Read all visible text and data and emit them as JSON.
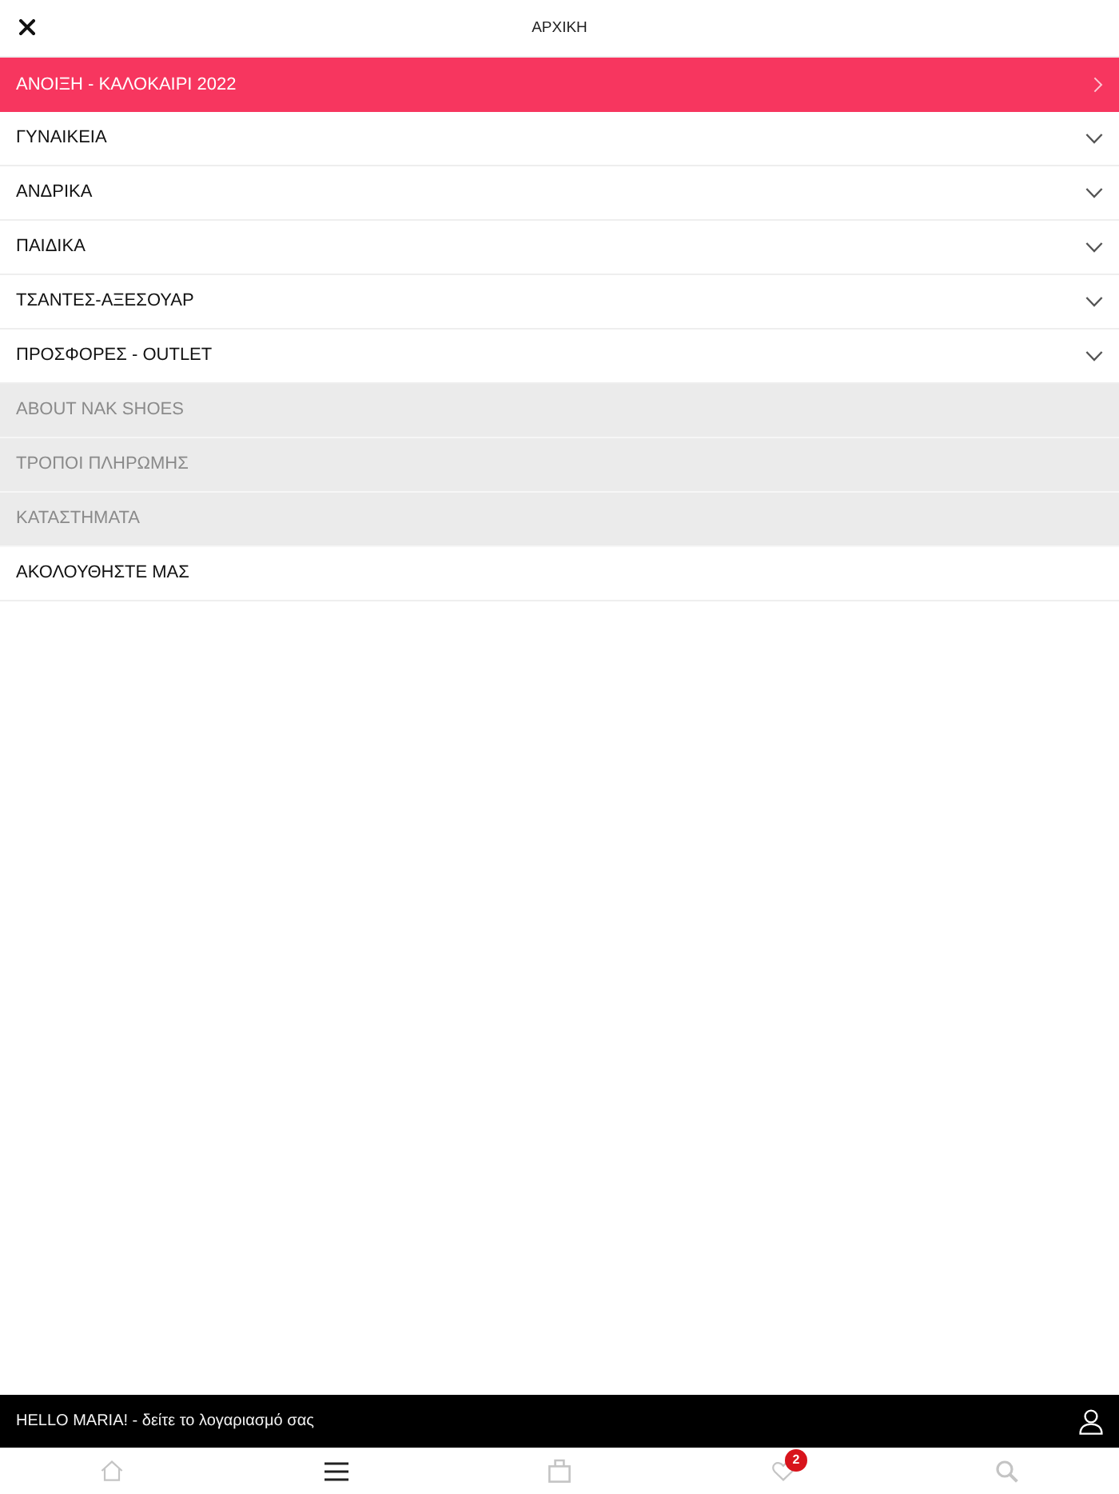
{
  "header": {
    "title": "ΑΡΧΙΚΗ"
  },
  "menu": [
    {
      "kind": "promo",
      "label": "ΑΝΟΙΞΗ - ΚΑΛΟΚΑΙΡΙ 2022"
    },
    {
      "kind": "category",
      "label": "ΓΥΝΑΙΚΕΙΑ",
      "expanded": false
    },
    {
      "kind": "category",
      "label": "ΑΝΔΡΙΚΑ",
      "expanded": false
    },
    {
      "kind": "category",
      "label": "ΠΑΙΔΙΚΑ",
      "expanded": false
    },
    {
      "kind": "category",
      "label": "ΤΣΑΝΤΕΣ-ΑΞΕΣΟΥΑΡ",
      "expanded": false
    },
    {
      "kind": "category",
      "label": "ΠΡΟΣΦΟΡΕΣ - OUTLET",
      "expanded": false
    },
    {
      "kind": "info",
      "label": "ABOUT NAK SHOES"
    },
    {
      "kind": "info",
      "label": "ΤΡΟΠΟΙ ΠΛΗΡΩΜΗΣ"
    },
    {
      "kind": "info",
      "label": "ΚΑΤΑΣΤΗΜΑΤΑ"
    },
    {
      "kind": "plain",
      "label": "ΑΚΟΛΟΥΘΗΣΤΕ ΜΑΣ"
    }
  ],
  "account_bar": {
    "text": "HELLO MARIA! - δείτε το λογαριασμό σας"
  },
  "bottom_nav": [
    {
      "kind": "home",
      "selected": false
    },
    {
      "kind": "menu",
      "selected": true
    },
    {
      "kind": "bag",
      "selected": false
    },
    {
      "kind": "heart",
      "selected": false,
      "badge": "2"
    },
    {
      "kind": "search",
      "selected": false
    }
  ]
}
